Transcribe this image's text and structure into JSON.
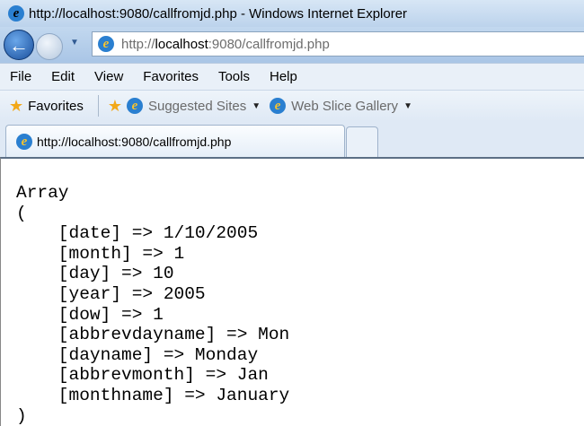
{
  "window": {
    "title": "http://localhost:9080/callfromjd.php - Windows Internet Explorer"
  },
  "address": {
    "prefix": "http://",
    "host": "localhost",
    "rest": ":9080/callfromjd.php"
  },
  "menu": [
    "File",
    "Edit",
    "View",
    "Favorites",
    "Tools",
    "Help"
  ],
  "favorites": {
    "label": "Favorites",
    "suggested": "Suggested Sites",
    "webslice": "Web Slice Gallery"
  },
  "tab": {
    "title": "http://localhost:9080/callfromjd.php"
  },
  "output": {
    "lines": [
      "Array",
      "(",
      "    [date] => 1/10/2005",
      "    [month] => 1",
      "    [day] => 10",
      "    [year] => 2005",
      "    [dow] => 1",
      "    [abbrevdayname] => Mon",
      "    [dayname] => Monday",
      "    [abbrevmonth] => Jan",
      "    [monthname] => January",
      ")"
    ]
  }
}
